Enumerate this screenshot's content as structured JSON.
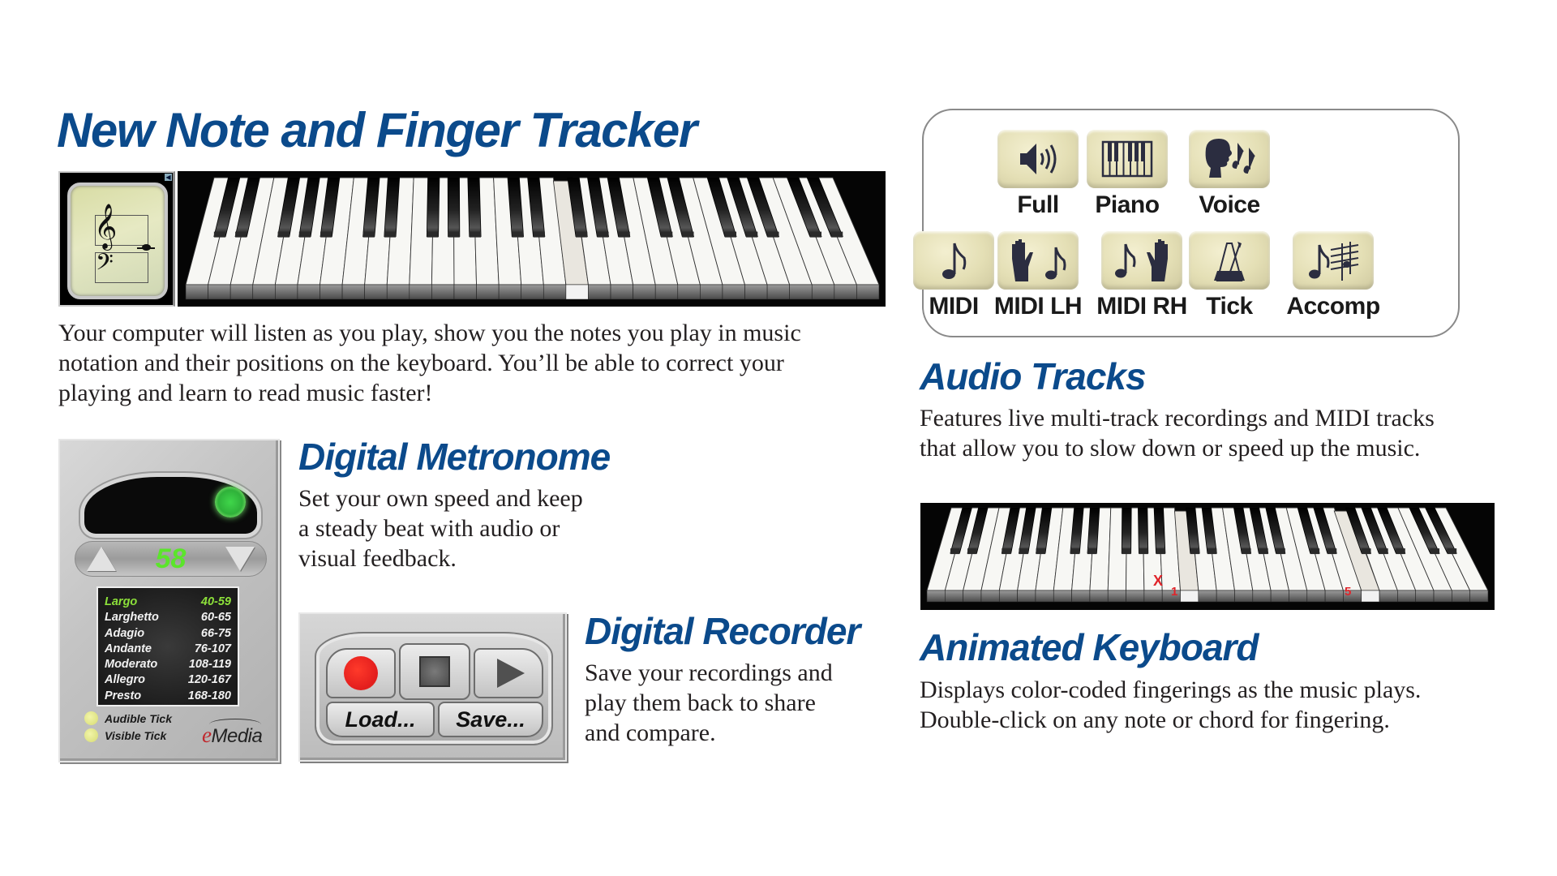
{
  "sections": {
    "note_tracker": {
      "title": "New Note and Finger Tracker",
      "body": [
        "Your computer will listen as you play, show you the notes you play in music",
        "notation and their positions on the keyboard. You’ll be able to correct your",
        "playing and learn to read music faster!"
      ],
      "keyboard": {
        "white_keys": 31,
        "pressed_white_key_index": 17
      },
      "notation_icons": {
        "treble_clef": "treble-clef-icon",
        "bass_clef": "bass-clef-icon",
        "note": "quarter-note-icon",
        "collapse": "collapse-arrow-icon"
      }
    },
    "metronome": {
      "title": "Digital Metronome",
      "body": [
        "Set your own speed and keep",
        "a steady beat with audio or",
        "visual feedback."
      ],
      "tempo": "58",
      "tempo_markings": [
        {
          "name": "Largo",
          "range": "40-59",
          "active": true
        },
        {
          "name": "Larghetto",
          "range": "60-65",
          "active": false
        },
        {
          "name": "Adagio",
          "range": "66-75",
          "active": false
        },
        {
          "name": "Andante",
          "range": "76-107",
          "active": false
        },
        {
          "name": "Moderato",
          "range": "108-119",
          "active": false
        },
        {
          "name": "Allegro",
          "range": "120-167",
          "active": false
        },
        {
          "name": "Presto",
          "range": "168-180",
          "active": false
        }
      ],
      "options": [
        "Audible Tick",
        "Visible Tick"
      ],
      "brand": {
        "e": "e",
        "rest": "Media"
      }
    },
    "recorder": {
      "title": "Digital Recorder",
      "body": [
        "Save your recordings and",
        "play them back to share",
        "and compare."
      ],
      "buttons": {
        "load": "Load...",
        "save": "Save..."
      }
    },
    "audio_tracks": {
      "title": "Audio Tracks",
      "body": [
        "Features live multi-track recordings and MIDI tracks",
        "that allow you to slow down or speed up the music."
      ],
      "tracks": [
        {
          "label": "Full",
          "icon": "speaker-icon"
        },
        {
          "label": "Piano",
          "icon": "piano-keys-icon"
        },
        {
          "label": "Voice",
          "icon": "singing-head-icon"
        },
        {
          "label": "MIDI",
          "icon": "eighth-note-icon"
        },
        {
          "label": "MIDI LH",
          "icon": "left-hand-note-icon"
        },
        {
          "label": "MIDI RH",
          "icon": "note-right-hand-icon"
        },
        {
          "label": "Tick",
          "icon": "metronome-icon"
        },
        {
          "label": "Accomp",
          "icon": "note-score-icon"
        }
      ]
    },
    "animated_keyboard": {
      "title": "Animated Keyboard",
      "body": [
        "Displays color-coded fingerings as the music plays.",
        "Double-click on any note or chord for fingering."
      ],
      "keyboard": {
        "white_keys": 31
      },
      "finger_marks": [
        "X",
        "1",
        "5"
      ],
      "accent_color": "#e0242a"
    }
  },
  "colors": {
    "heading": "#0b4a8b",
    "body": "#231f20",
    "tempo_display": "#5be52b"
  }
}
